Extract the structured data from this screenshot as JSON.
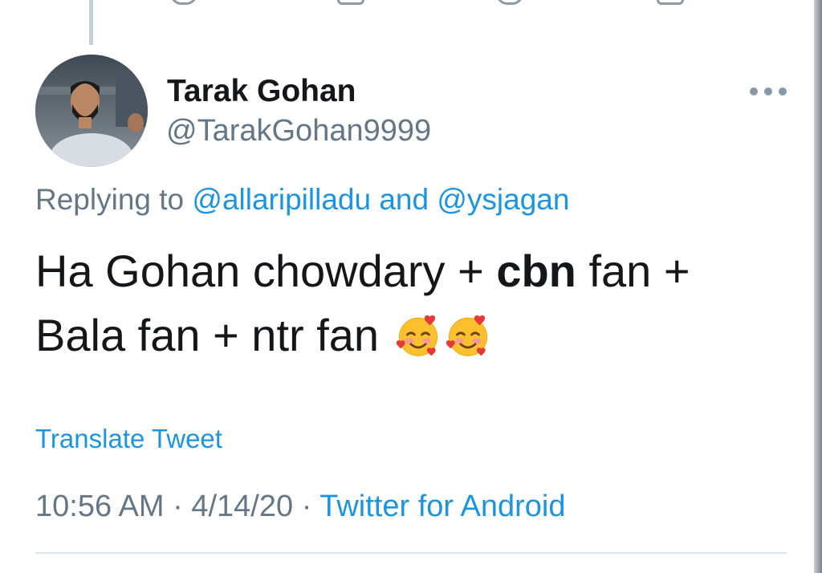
{
  "tweet": {
    "display_name": "Tarak Gohan",
    "handle": "@TarakGohan9999",
    "replying_prefix": "Replying to ",
    "reply_mention_1": "@allaripilladu",
    "reply_and": " and ",
    "reply_mention_2": "@ysjagan",
    "text_part_1": "Ha Gohan chowdary + ",
    "text_bold": "cbn",
    "text_part_2": " fan + Bala fan + ntr fan ",
    "emojis": [
      "smiling-face-with-hearts-icon",
      "smiling-face-with-hearts-icon"
    ],
    "translate_label": "Translate Tweet",
    "time": "10:56 AM",
    "separator_1": " · ",
    "date": "4/14/20",
    "separator_2": " · ",
    "source": "Twitter for Android"
  },
  "colors": {
    "link": "#1b95e0",
    "secondary_text": "#657786",
    "primary_text": "#14171a",
    "divider": "#e1e8ed"
  }
}
